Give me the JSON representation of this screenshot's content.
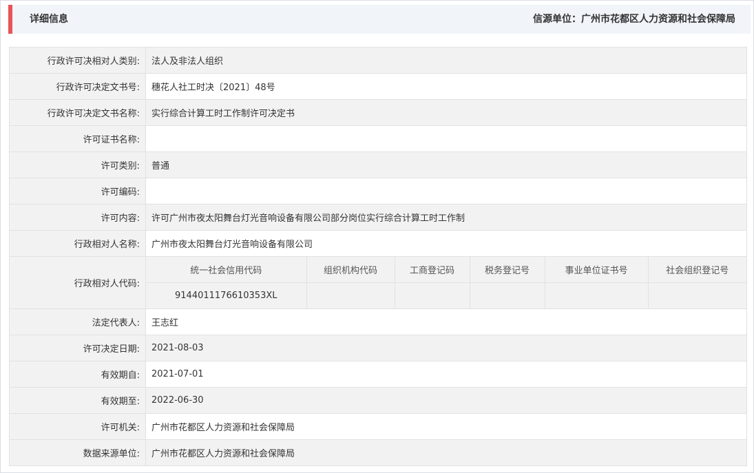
{
  "header": {
    "title": "详细信息",
    "source": "信源单位：广州市花都区人力资源和社会保障局",
    "accent_color": "#e8545a"
  },
  "rows_top": [
    {
      "label": "行政许可决相对人类别:",
      "value": "法人及非法人组织"
    },
    {
      "label": "行政许可决定文书号:",
      "value": "穗花人社工时决〔2021〕48号"
    },
    {
      "label": "行政许可决定文书名称:",
      "value": "实行综合计算工时工作制许可决定书"
    },
    {
      "label": "许可证书名称:",
      "value": ""
    },
    {
      "label": "许可类别:",
      "value": "普通"
    },
    {
      "label": "许可编码:",
      "value": ""
    },
    {
      "label": "许可内容:",
      "value": "许可广州市夜太阳舞台灯光音响设备有限公司部分岗位实行综合计算工时工作制"
    },
    {
      "label": "行政相对人名称:",
      "value": "广州市夜太阳舞台灯光音响设备有限公司"
    }
  ],
  "codes": {
    "label": "行政相对人代码:",
    "headers": [
      "统一社会信用代码",
      "组织机构代码",
      "工商登记码",
      "税务登记号",
      "事业单位证书号",
      "社会组织登记号"
    ],
    "values": [
      "91440111766103 53XL",
      "",
      "",
      "",
      "",
      ""
    ]
  },
  "rows_bottom": [
    {
      "label": "法定代表人:",
      "value": "王志红"
    },
    {
      "label": "许可决定日期:",
      "value": "2021-08-03"
    },
    {
      "label": "有效期自:",
      "value": "2021-07-01"
    },
    {
      "label": "有效期至:",
      "value": "2022-06-30"
    },
    {
      "label": "许可机关:",
      "value": "广州市花都区人力资源和社会保障局"
    },
    {
      "label": "数据来源单位:",
      "value": "广州市花都区人力资源和社会保障局"
    }
  ]
}
